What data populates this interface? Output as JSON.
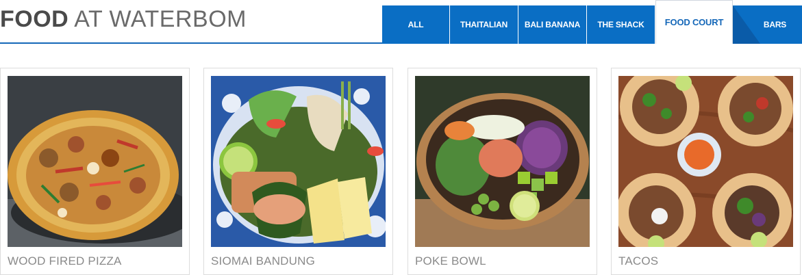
{
  "header": {
    "title_bold": "FOOD",
    "title_light": "AT WATERBOM"
  },
  "tabs": [
    {
      "label": "ALL",
      "active": false
    },
    {
      "label": "THAITALIAN",
      "active": false
    },
    {
      "label": "BALI BANANA",
      "active": false
    },
    {
      "label": "THE SHACK",
      "active": false
    },
    {
      "label": "FOOD COURT",
      "active": true
    },
    {
      "label": "BARS",
      "active": false
    }
  ],
  "cards": [
    {
      "caption": "WOOD FIRED PIZZA",
      "image": "pizza-photo"
    },
    {
      "caption": "SIOMAI BANDUNG",
      "image": "siomai-photo"
    },
    {
      "caption": "POKE BOWL",
      "image": "poke-bowl-photo"
    },
    {
      "caption": "TACOS",
      "image": "tacos-photo"
    }
  ],
  "colors": {
    "tab_blue": "#0a6ec4",
    "accent_line": "#1467b8",
    "caption_gray": "#8a8a8a"
  }
}
